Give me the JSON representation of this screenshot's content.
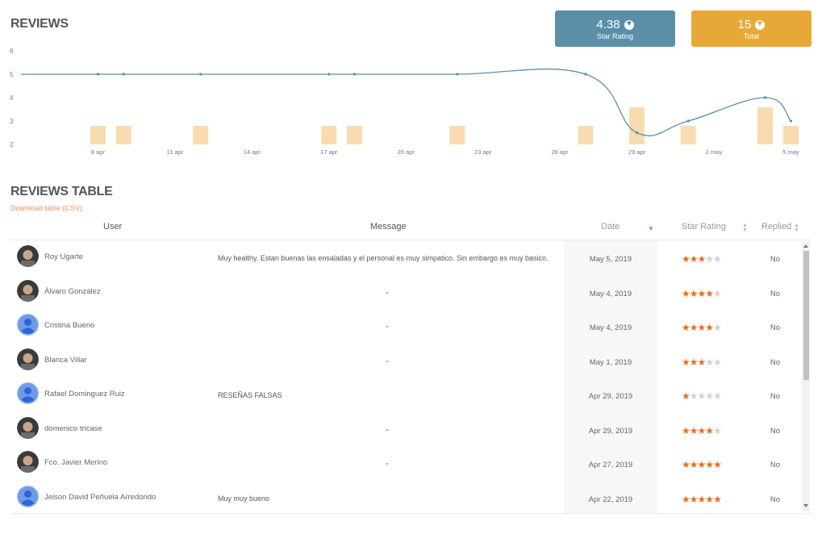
{
  "reviews_title": "REVIEWS",
  "kpis": {
    "rating": {
      "value": "4.38",
      "label": "Star Rating",
      "color": "#5b8fa8"
    },
    "total": {
      "value": "15",
      "label": "Total",
      "color": "#e8a838"
    }
  },
  "chart_data": {
    "type": "line",
    "title": "",
    "y_ticks": [
      "2",
      "3",
      "4",
      "5",
      "6"
    ],
    "ylim": [
      2,
      6
    ],
    "x_tick_labels": [
      "8 apr",
      "11 apr",
      "14 apr",
      "17 apr",
      "20 apr",
      "23 apr",
      "26 apr",
      "29 apr",
      "2 may",
      "5 may"
    ],
    "x_tick_days": [
      8,
      11,
      14,
      17,
      20,
      23,
      26,
      29,
      32,
      35
    ],
    "xlim_days": [
      5,
      35.3
    ],
    "line_series": {
      "name": "Star Rating",
      "color": "#5b8fa8",
      "points": [
        [
          5,
          5
        ],
        [
          8,
          5
        ],
        [
          9,
          5
        ],
        [
          12,
          5
        ],
        [
          17,
          5
        ],
        [
          18,
          5
        ],
        [
          22,
          5
        ],
        [
          27,
          5
        ],
        [
          29,
          2.5
        ],
        [
          31,
          3
        ],
        [
          34,
          4
        ],
        [
          35,
          3
        ]
      ]
    },
    "bar_series": {
      "name": "Reviews",
      "color": "#f8dcb0",
      "points": [
        [
          8,
          1
        ],
        [
          9,
          1
        ],
        [
          12,
          1
        ],
        [
          17,
          1
        ],
        [
          18,
          1
        ],
        [
          22,
          1
        ],
        [
          27,
          1
        ],
        [
          29,
          2
        ],
        [
          31,
          1
        ],
        [
          34,
          2
        ],
        [
          35,
          1
        ]
      ]
    },
    "grid": false
  },
  "table_title": "REVIEWS TABLE",
  "download_label": "Download table (CSV)",
  "columns": {
    "user": "User",
    "message": "Message",
    "date": "Date",
    "rating": "Star Rating",
    "replied": "Replied"
  },
  "rows": [
    {
      "user": "Roy Ugarte",
      "message": "Muy healthy. Estan buenas las ensaladas y el personal es muy simpatico. Sin embargo es muy basico.",
      "date": "May 5, 2019",
      "rating": 3,
      "replied": "No",
      "avatar": "photo"
    },
    {
      "user": "Álvaro González",
      "message": "-",
      "date": "May 4, 2019",
      "rating": 4,
      "replied": "No",
      "avatar": "photo"
    },
    {
      "user": "Cristina Bueno",
      "message": "-",
      "date": "May 4, 2019",
      "rating": 4,
      "replied": "No",
      "avatar": "default"
    },
    {
      "user": "Blanca Villar",
      "message": "-",
      "date": "May 1, 2019",
      "rating": 3,
      "replied": "No",
      "avatar": "photo"
    },
    {
      "user": "Rafael Dominguez Ruiz",
      "message": "RESEÑAS FALSAS",
      "date": "Apr 29, 2019",
      "rating": 1,
      "replied": "No",
      "avatar": "default"
    },
    {
      "user": "domenico tricase",
      "message": "-",
      "date": "Apr 29, 2019",
      "rating": 4,
      "replied": "No",
      "avatar": "photo"
    },
    {
      "user": "Fco. Javier Merino",
      "message": "-",
      "date": "Apr 27, 2019",
      "rating": 5,
      "replied": "No",
      "avatar": "photo"
    },
    {
      "user": "Jeison David Peñuela Arredondo",
      "message": "Muy muy bueno",
      "date": "Apr 22, 2019",
      "rating": 5,
      "replied": "No",
      "avatar": "default"
    }
  ],
  "star_colors": {
    "filled": "#e86e1c",
    "empty": "#d0d0d0"
  }
}
